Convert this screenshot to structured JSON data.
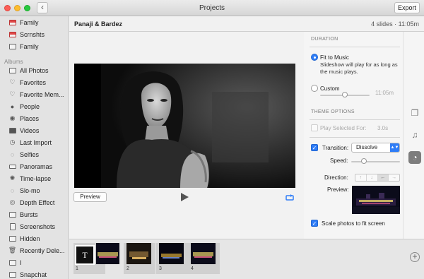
{
  "window": {
    "title": "Projects",
    "back_icon": "chevron-left-icon",
    "export_label": "Export"
  },
  "sidebar": {
    "top_items": [
      {
        "label": "Family",
        "icon": "album-icon"
      },
      {
        "label": "Scrnshts",
        "icon": "album-icon"
      },
      {
        "label": "Family",
        "icon": "album-icon"
      }
    ],
    "albums_header": "Albums",
    "items": [
      {
        "label": "All Photos",
        "icon": "photos-icon"
      },
      {
        "label": "Favorites",
        "icon": "heart-icon"
      },
      {
        "label": "Favorite Mem...",
        "icon": "heart-memories-icon"
      },
      {
        "label": "People",
        "icon": "person-icon"
      },
      {
        "label": "Places",
        "icon": "pin-icon"
      },
      {
        "label": "Videos",
        "icon": "video-icon"
      },
      {
        "label": "Last Import",
        "icon": "clock-icon"
      },
      {
        "label": "Selfies",
        "icon": "selfie-icon"
      },
      {
        "label": "Panoramas",
        "icon": "panorama-icon"
      },
      {
        "label": "Time-lapse",
        "icon": "timelapse-icon"
      },
      {
        "label": "Slo-mo",
        "icon": "slomo-icon"
      },
      {
        "label": "Depth Effect",
        "icon": "depth-icon"
      },
      {
        "label": "Bursts",
        "icon": "bursts-icon"
      },
      {
        "label": "Screenshots",
        "icon": "screenshot-icon"
      },
      {
        "label": "Hidden",
        "icon": "hidden-icon"
      },
      {
        "label": "Recently Dele...",
        "icon": "trash-icon"
      },
      {
        "label": "I",
        "icon": "album-icon"
      },
      {
        "label": "Snapchat",
        "icon": "album-icon"
      }
    ]
  },
  "project": {
    "name": "Panaji & Bardez",
    "info": "4 slides · 11:05m"
  },
  "preview": {
    "preview_label": "Preview",
    "play_icon": "play-icon",
    "loop_icon": "loop-icon"
  },
  "settings": {
    "duration_title": "DURATION",
    "fit_to_music_label": "Fit to Music",
    "fit_to_music_note": "Slideshow will play for as long as the music plays.",
    "custom_label": "Custom",
    "custom_time": "11:05m",
    "theme_title": "THEME OPTIONS",
    "play_selected_label": "Play Selected For:",
    "play_selected_value": "3.0s",
    "transition_label": "Transition:",
    "transition_value": "Dissolve",
    "speed_label": "Speed:",
    "direction_label": "Direction:",
    "direction_options": [
      "↑",
      "↓",
      "←",
      "→"
    ],
    "direction_selected": 2,
    "preview_label": "Preview:",
    "scale_label": "Scale photos to fit screen",
    "fit_to_music_selected": true,
    "transition_checked": true,
    "scale_checked": true
  },
  "tools": [
    {
      "icon": "themes-icon"
    },
    {
      "icon": "music-icon"
    },
    {
      "icon": "duration-icon"
    }
  ],
  "filmstrip": {
    "title_glyph": "T",
    "slides": [
      {
        "number": "1"
      },
      {
        "number": "2"
      },
      {
        "number": "3"
      },
      {
        "number": "4"
      }
    ],
    "add_label": "+"
  }
}
